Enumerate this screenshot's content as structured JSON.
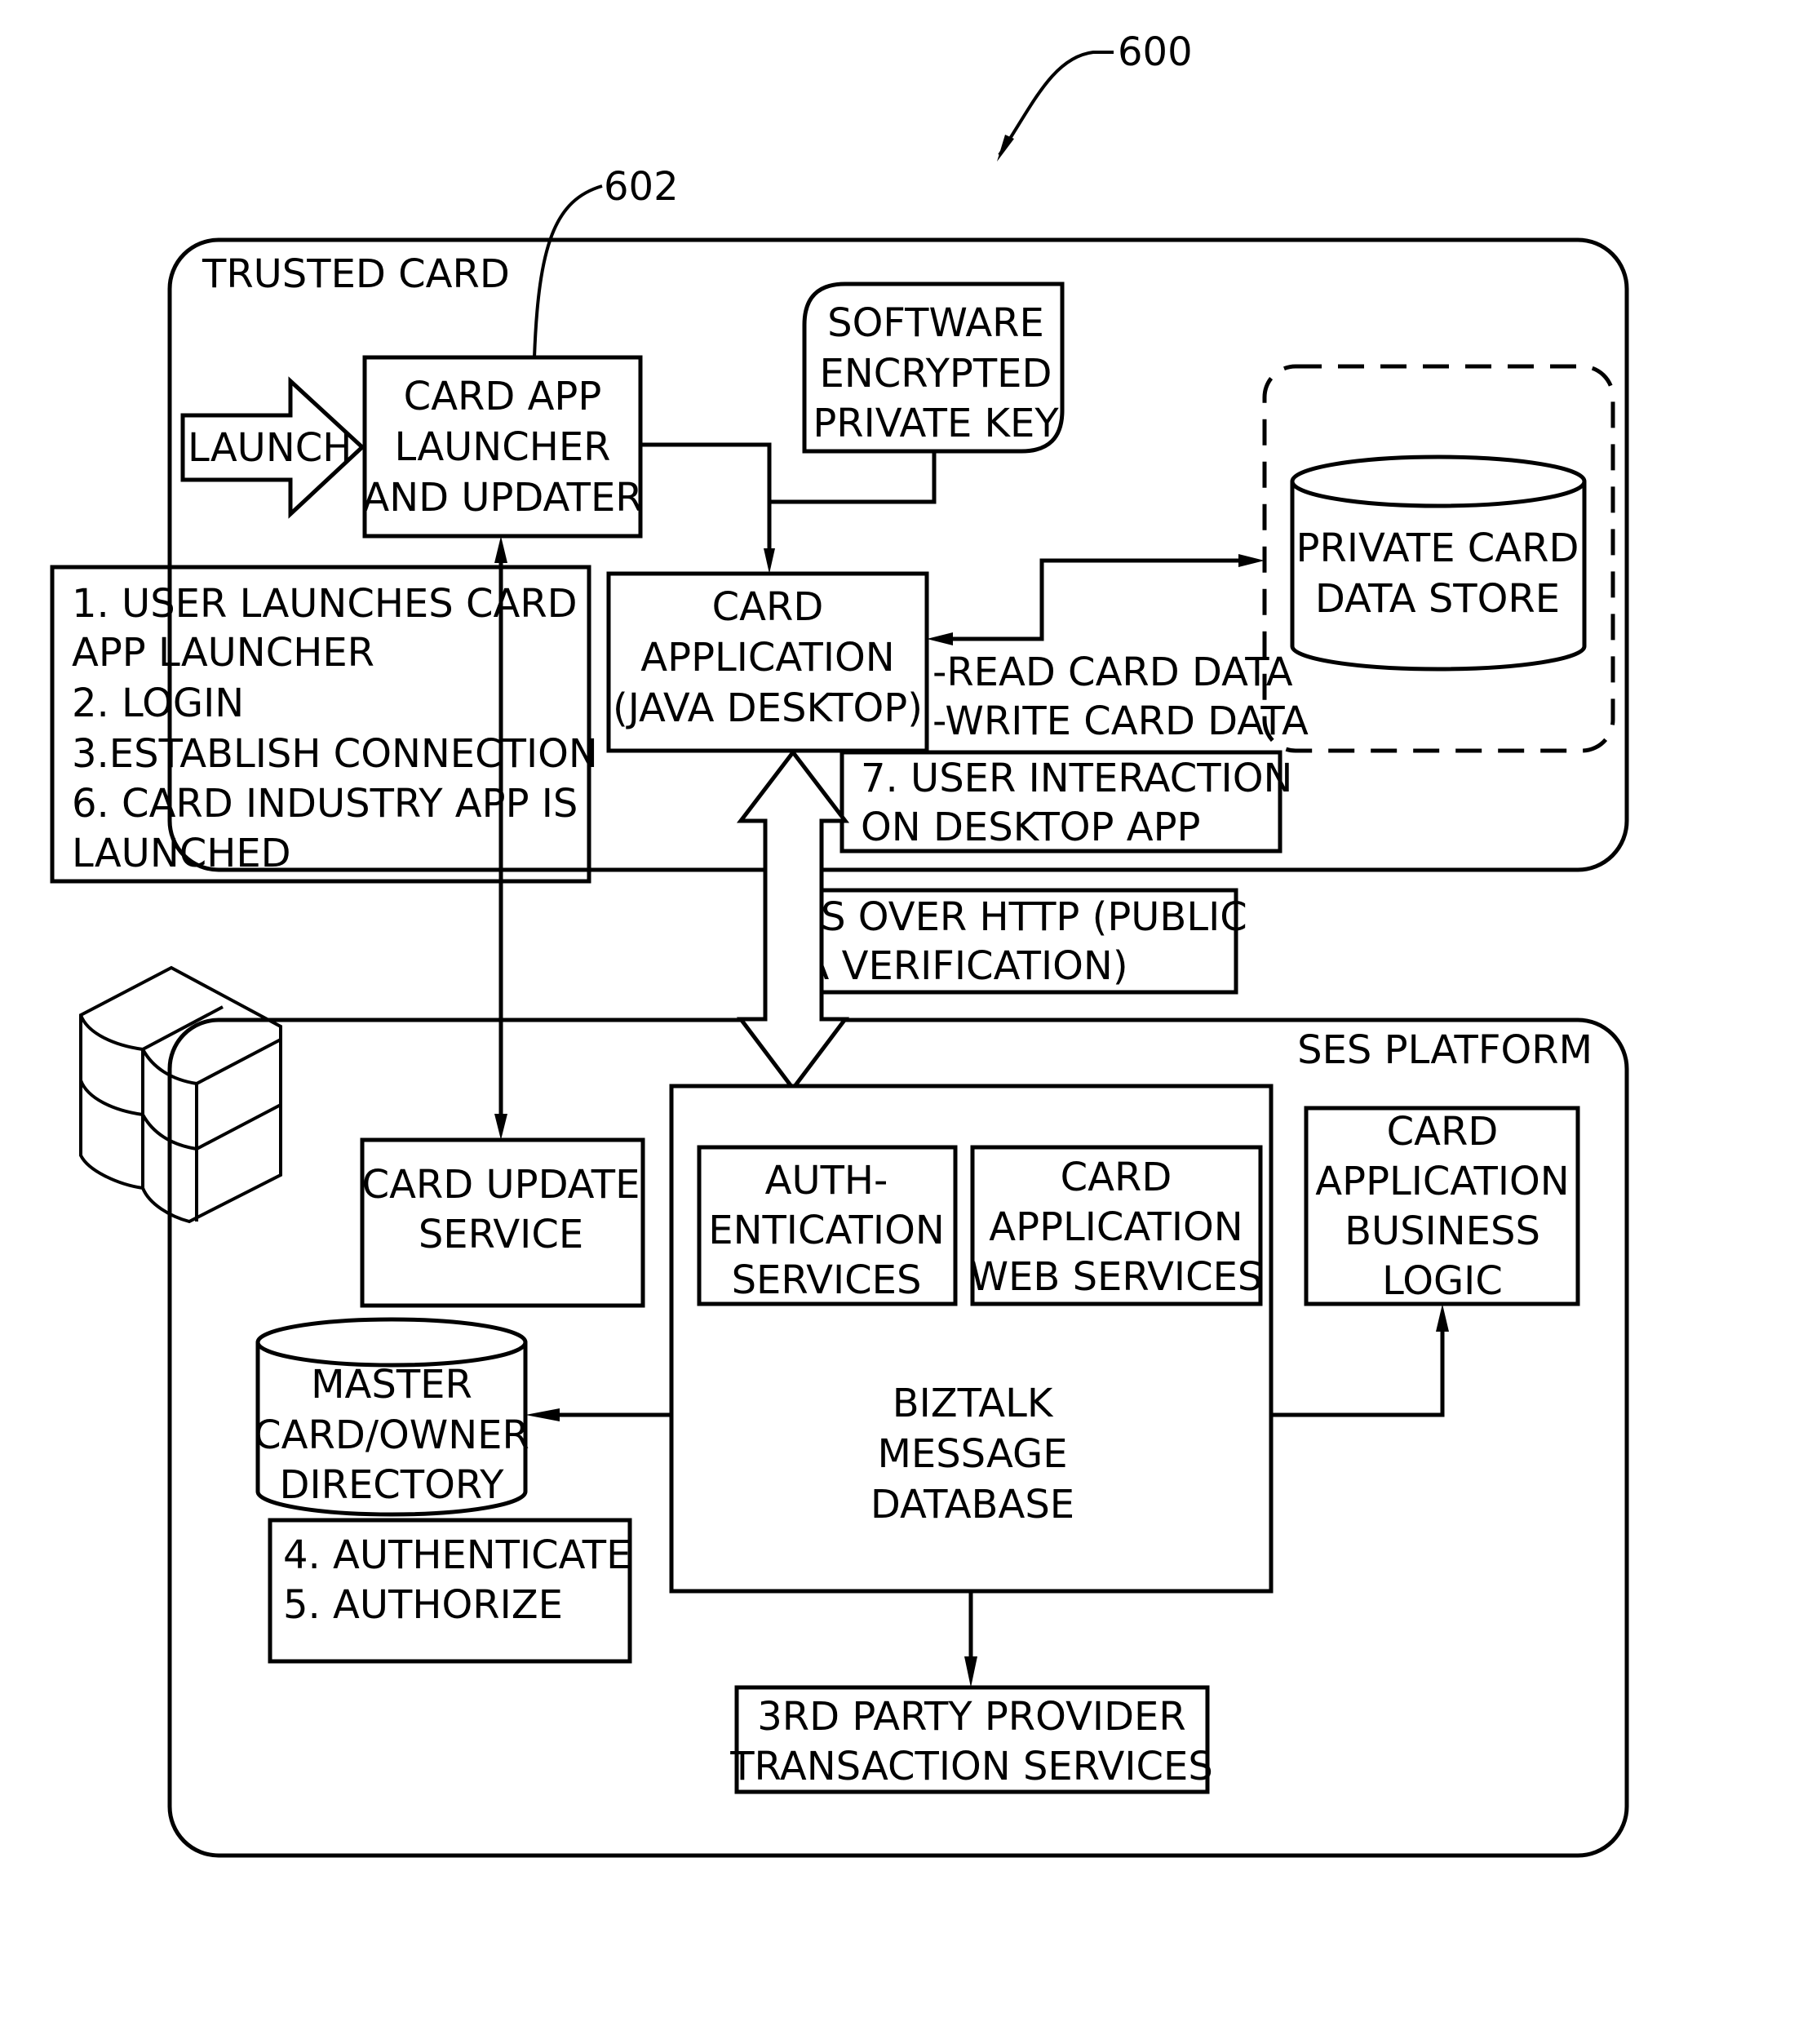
{
  "figure": {
    "reference_numerals": {
      "system": "600",
      "launcher": "602"
    }
  },
  "trusted_card": {
    "title": "TRUSTED CARD",
    "launch_arrow_label": "LAUNCH",
    "launcher_box": [
      "CARD APP",
      "LAUNCHER",
      "AND UPDATER"
    ],
    "private_key_box": [
      "SOFTWARE",
      "ENCRYPTED",
      "PRIVATE KEY"
    ],
    "card_application_box": [
      "CARD",
      "APPLICATION",
      "(JAVA DESKTOP)"
    ],
    "data_store": [
      "PRIVATE CARD",
      "DATA STORE"
    ],
    "read_write_labels": [
      "-READ CARD DATA",
      "-WRITE CARD DATA"
    ],
    "user_interaction_note": [
      "7. USER INTERACTION",
      "ON DESKTOP APP"
    ]
  },
  "steps_note": [
    "1. USER LAUNCHES CARD",
    "APP LAUNCHER",
    "2. LOGIN",
    "3.ESTABLISH CONNECTION",
    "6. CARD INDUSTRY APP IS",
    "LAUNCHED"
  ],
  "connection_label": [
    "TLS OVER HTTP (PUBLIC",
    "CA VERIFICATION)"
  ],
  "ses_platform": {
    "title": "SES PLATFORM",
    "card_update_service": [
      "CARD UPDATE",
      "SERVICE"
    ],
    "authentication_services": [
      "AUTH-",
      "ENTICATION",
      "SERVICES"
    ],
    "card_app_web_services": [
      "CARD",
      "APPLICATION",
      "WEB SERVICES"
    ],
    "business_logic": [
      "CARD",
      "APPLICATION",
      "BUSINESS",
      "LOGIC"
    ],
    "biztalk": [
      "BIZTALK",
      "MESSAGE",
      "DATABASE"
    ],
    "master_directory": [
      "MASTER",
      "CARD/OWNER",
      "DIRECTORY"
    ],
    "auth_steps_note": [
      "4. AUTHENTICATE",
      "5. AUTHORIZE"
    ],
    "third_party": [
      "3RD PARTY PROVIDER",
      "TRANSACTION SERVICES"
    ]
  },
  "icons": {
    "server": "server-stack-icon"
  }
}
